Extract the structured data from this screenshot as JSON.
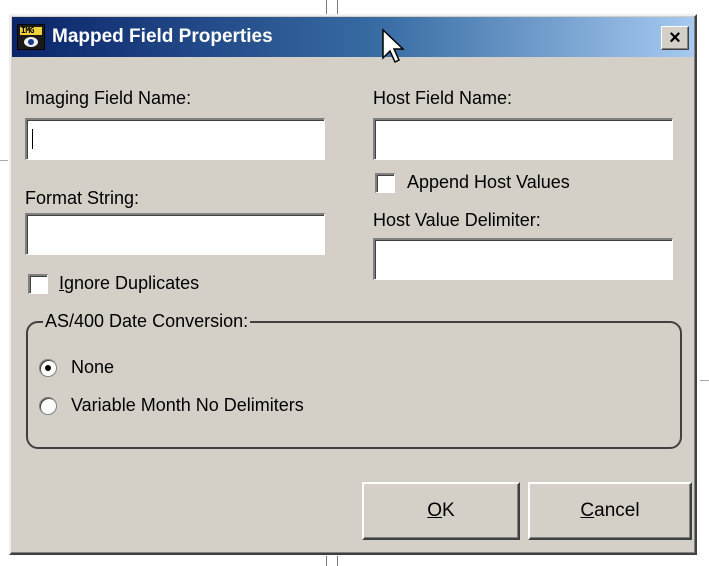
{
  "window": {
    "title": "Mapped Field Properties",
    "close_label": "×",
    "icon": "imaging-app-icon",
    "icon_text": "IMG"
  },
  "fields": {
    "imaging_field_name": {
      "label": "Imaging Field Name:",
      "value": ""
    },
    "host_field_name": {
      "label": "Host Field Name:",
      "value": ""
    },
    "format_string": {
      "label": "Format String:",
      "value": ""
    },
    "host_value_delimiter": {
      "label": "Host Value Delimiter:",
      "value": ""
    }
  },
  "checkboxes": {
    "append_host_values": {
      "label": "Append Host Values",
      "checked": false
    },
    "ignore_duplicates": {
      "label": "Ignore Duplicates",
      "checked": false
    }
  },
  "date_conversion": {
    "legend": "AS/400 Date Conversion:",
    "options": [
      {
        "label": "None",
        "selected": true
      },
      {
        "label": "Variable Month No Delimiters",
        "selected": false
      }
    ]
  },
  "buttons": {
    "ok_accel": "O",
    "ok_rest": "K",
    "cancel_accel": "C",
    "cancel_rest": "ancel"
  },
  "colors": {
    "titlebar_start": "#0a246a",
    "titlebar_end": "#a6caf0",
    "dialog_face": "#d4d0c8"
  }
}
